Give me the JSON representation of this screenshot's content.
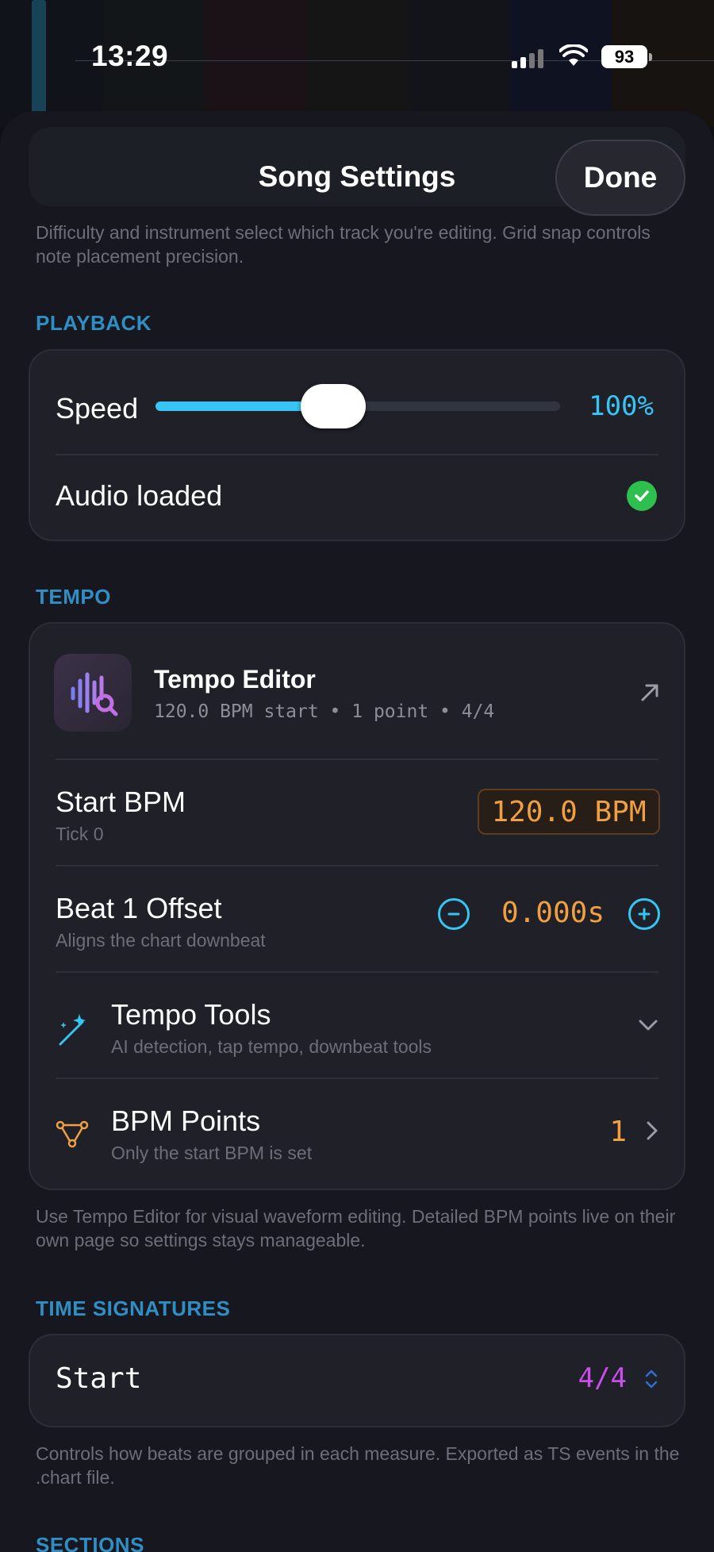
{
  "status_bar": {
    "time": "13:29",
    "battery": "93"
  },
  "sheet": {
    "title": "Song Settings",
    "done_label": "Done"
  },
  "intro_text": "Difficulty and instrument select which track you're editing. Grid snap controls note placement precision.",
  "playback": {
    "header": "PLAYBACK",
    "speed_label": "Speed",
    "speed_value": "100%",
    "speed_fraction": 0.44,
    "audio_label": "Audio loaded",
    "audio_status_icon": "check-circle-icon",
    "accent_color": "#37c5f5",
    "success_color": "#2fbf4f"
  },
  "tempo": {
    "header": "TEMPO",
    "editor_title": "Tempo Editor",
    "editor_subtitle": "120.0 BPM start • 1 point • 4/4",
    "start_bpm_label": "Start BPM",
    "start_bpm_sub": "Tick 0",
    "start_bpm_value": "120.0 BPM",
    "offset_label": "Beat 1 Offset",
    "offset_sub": "Aligns the chart downbeat",
    "offset_value": "0.000s",
    "tools_label": "Tempo Tools",
    "tools_sub": "AI detection, tap tempo, downbeat tools",
    "points_label": "BPM Points",
    "points_sub": "Only the start BPM is set",
    "points_count": "1",
    "footnote": "Use Tempo Editor for visual waveform editing. Detailed BPM points live on their own page so settings stays manageable.",
    "value_color": "#f0a040"
  },
  "time_signatures": {
    "header": "TIME SIGNATURES",
    "start_label": "Start",
    "start_value": "4/4",
    "footnote": "Controls how beats are grouped in each measure. Exported as TS events in the .chart file.",
    "value_color": "#c94fe8"
  },
  "sections": {
    "header": "SECTIONS"
  }
}
